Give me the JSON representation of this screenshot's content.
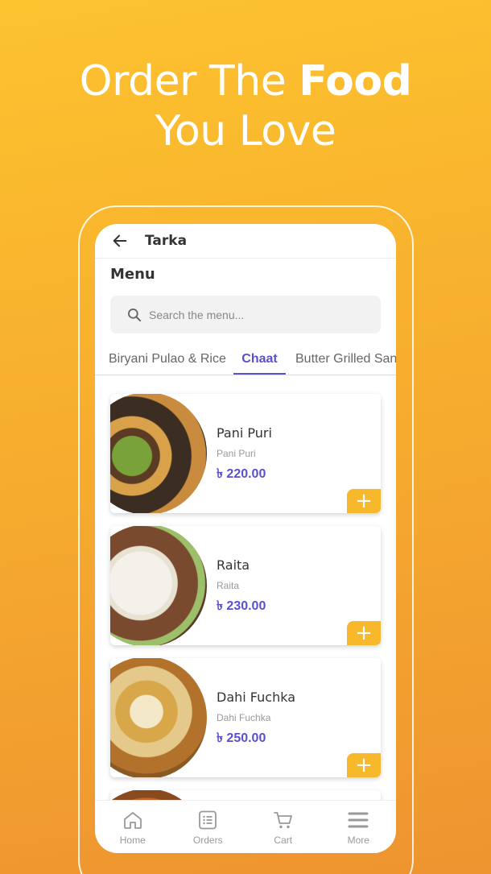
{
  "headline": {
    "line1_regular": "Order The ",
    "line1_bold": "Food",
    "line2": "You Love"
  },
  "appbar": {
    "title": "Tarka",
    "back_icon": "arrow-left-icon"
  },
  "menu": {
    "heading": "Menu"
  },
  "search": {
    "placeholder": "Search the menu...",
    "value": "",
    "icon": "search-icon"
  },
  "tabs": [
    {
      "label": "Biryani Pulao & Rice",
      "active": false
    },
    {
      "label": "Chaat",
      "active": true
    },
    {
      "label": "Butter Grilled San",
      "active": false
    }
  ],
  "items": [
    {
      "name": "Pani Puri",
      "desc": "Pani Puri",
      "price": "৳ 220.00",
      "add": "+"
    },
    {
      "name": "Raita",
      "desc": "Raita",
      "price": "৳ 230.00",
      "add": "+"
    },
    {
      "name": "Dahi Fuchka",
      "desc": "Dahi Fuchka",
      "price": "৳ 250.00",
      "add": "+"
    }
  ],
  "nav": [
    {
      "label": "Home",
      "icon": "home-icon"
    },
    {
      "label": "Orders",
      "icon": "orders-icon"
    },
    {
      "label": "Cart",
      "icon": "cart-icon"
    },
    {
      "label": "More",
      "icon": "menu-icon"
    }
  ],
  "colors": {
    "accent": "#5a4fcf",
    "brand": "#F8B82B",
    "background_top": "#FDC32F",
    "background_bottom": "#EE9430"
  }
}
